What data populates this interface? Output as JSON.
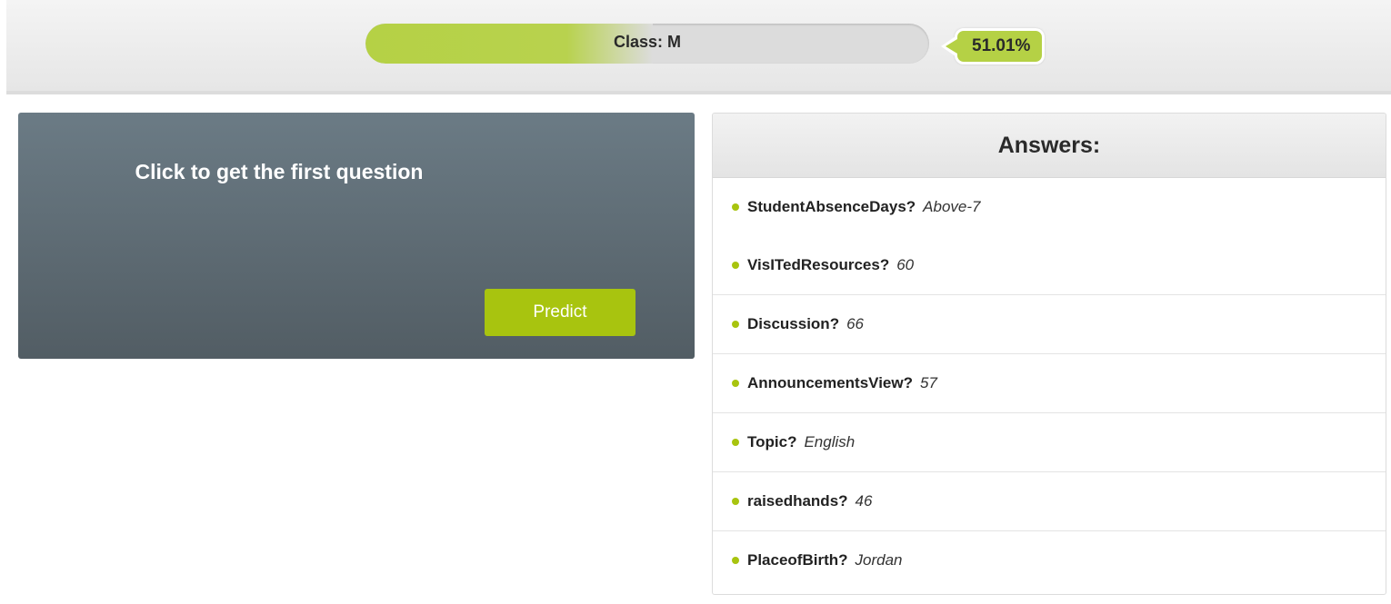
{
  "prediction": {
    "class_label": "Class: M",
    "confidence_text": "51.01%",
    "confidence_fraction": 0.5101
  },
  "question_panel": {
    "prompt": "Click to get the first question",
    "predict_button": "Predict"
  },
  "answers": {
    "title": "Answers:",
    "items": [
      {
        "question": "StudentAbsenceDays?",
        "answer": "Above-7"
      },
      {
        "question": "VisITedResources?",
        "answer": "60"
      },
      {
        "question": "Discussion?",
        "answer": "66"
      },
      {
        "question": "AnnouncementsView?",
        "answer": "57"
      },
      {
        "question": "Topic?",
        "answer": "English"
      },
      {
        "question": "raisedhands?",
        "answer": "46"
      },
      {
        "question": "PlaceofBirth?",
        "answer": "Jordan"
      }
    ]
  },
  "colors": {
    "accent_green": "#b5d145",
    "button_green": "#a8c40f",
    "panel_dark": "#5e6c75"
  }
}
